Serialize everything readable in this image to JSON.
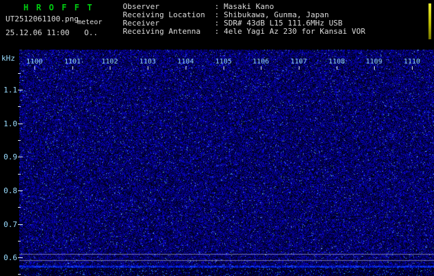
{
  "app": {
    "title": "H R O F F T"
  },
  "header": {
    "filename": "UT2512061100.png",
    "mode_label": "meteor",
    "datetime": "25.12.06 11:00",
    "counter": "O..",
    "info": [
      {
        "label": "Observer",
        "value": ": Masaki Kano"
      },
      {
        "label": "Receiving Location",
        "value": ": Shibukawa, Gunma, Japan"
      },
      {
        "label": "Receiver",
        "value": ": SDR# 43dB L15 111.6MHz USB"
      },
      {
        "label": "Receiving Antenna",
        "value": ": 4ele Yagi Az 230 for Kansai VOR"
      }
    ]
  },
  "chart_data": {
    "type": "heatmap",
    "title": "HROFFT radio meteor echo spectrogram",
    "x_ticks": [
      "1100",
      "1101",
      "1102",
      "1103",
      "1104",
      "1105",
      "1106",
      "1107",
      "1108",
      "1109",
      "1110"
    ],
    "x_axis_meaning": "time UT (hhmm), one tick per minute",
    "y_unit": "kHz",
    "y_ticks": [
      "1.1",
      "1.0",
      "0.9",
      "0.8",
      "0.7",
      "0.6"
    ],
    "ylim": [
      0.55,
      1.16
    ],
    "content": "uniform dark-blue background noise across whole band, no meteor echoes visible",
    "horizontal_lines_khz": [
      0.61,
      0.59
    ],
    "bright_noise_band_khz": 0.57,
    "colors": {
      "title_text": "#00cc11",
      "header_text": "#dcdcdc",
      "axis_text": "#8fd4f0",
      "noise_blue": "#2233cc",
      "carrier_line": "#c8cce6",
      "level_meter": "#cccc22"
    }
  }
}
